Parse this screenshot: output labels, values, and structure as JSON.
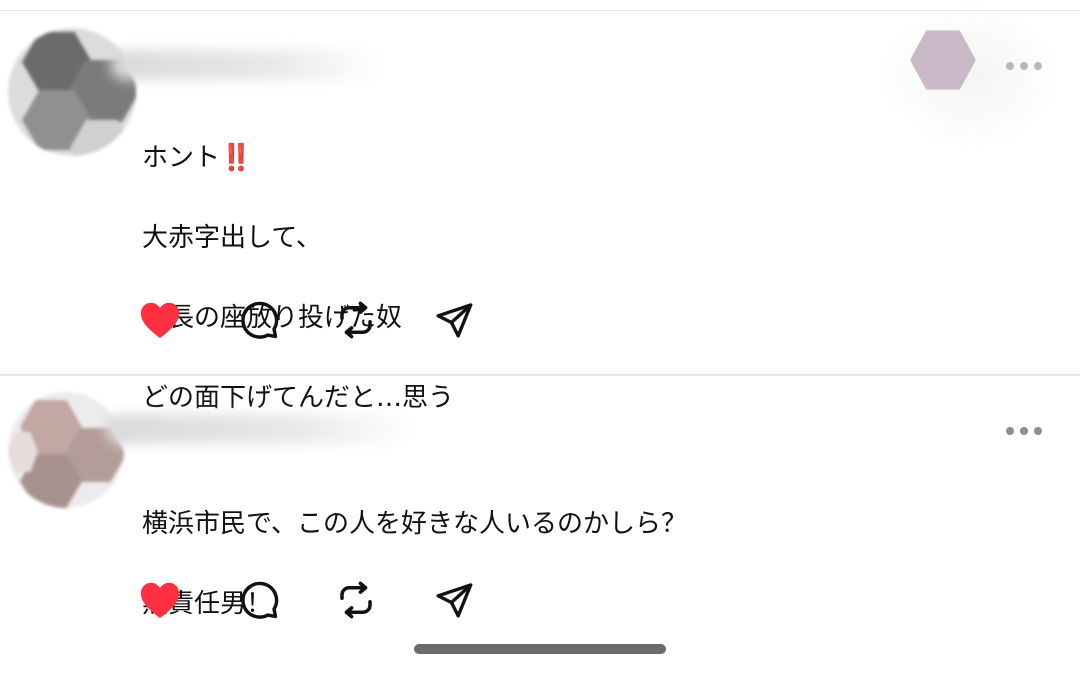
{
  "posts": [
    {
      "lines": [
        "ホント",
        "大赤字出して、",
        "市長の座放り投げた奴",
        "どの面下げてんだと…思う"
      ],
      "emphasis": "‼️",
      "actions": {
        "like": {
          "icon": "heart-icon",
          "liked": true,
          "color": "#ff3040"
        },
        "reply": {
          "icon": "comment-icon"
        },
        "repost": {
          "icon": "repost-icon"
        },
        "share": {
          "icon": "send-icon"
        }
      }
    },
    {
      "lines": [
        "横浜市民で、この人を好きな人いるのかしら？",
        "無責任男！"
      ],
      "actions": {
        "like": {
          "icon": "heart-icon",
          "liked": true,
          "color": "#ff3040"
        },
        "reply": {
          "icon": "comment-icon"
        },
        "repost": {
          "icon": "repost-icon"
        },
        "share": {
          "icon": "send-icon"
        }
      }
    }
  ],
  "colors": {
    "liked": "#ff3040",
    "text": "#111111",
    "icon_stroke": "#111111",
    "divider": "#e6e6e6",
    "more_dots": "#8e8e8e"
  }
}
